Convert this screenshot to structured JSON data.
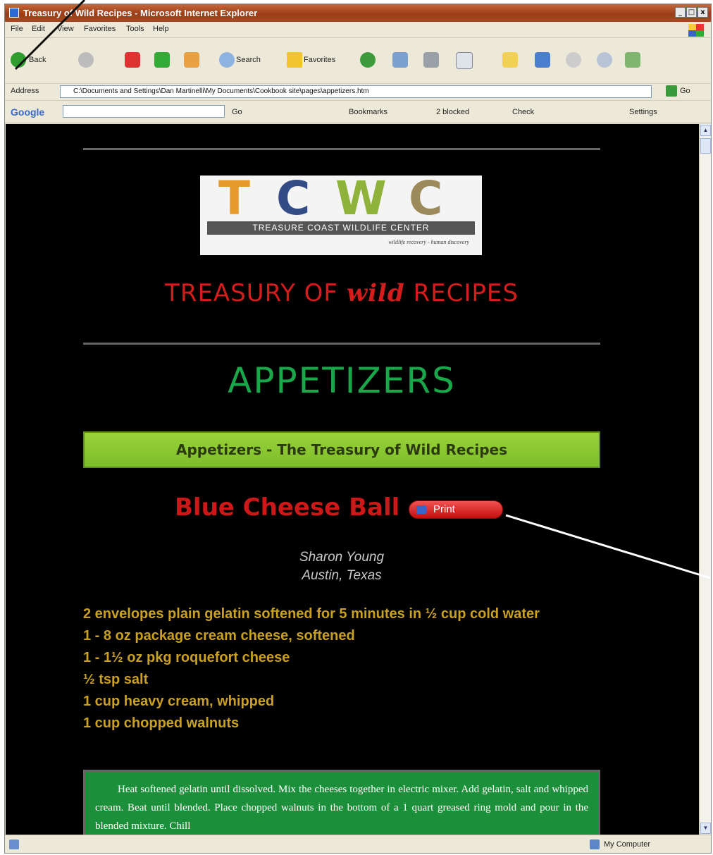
{
  "window": {
    "title": "Treasury of Wild Recipes - Microsoft Internet Explorer",
    "controls": [
      "_",
      "□",
      "x"
    ]
  },
  "menu": [
    "File",
    "Edit",
    "View",
    "Favorites",
    "Tools",
    "Help"
  ],
  "toolbar": {
    "back": "Back",
    "search": "Search",
    "favorites": "Favorites"
  },
  "address": {
    "label": "Address",
    "url": "C:\\Documents and Settings\\Dan Martinelli\\My Documents\\Cookbook site\\pages\\appetizers.htm",
    "go": "Go"
  },
  "google_bar": {
    "logo": "Google",
    "go": "Go",
    "bookmarks": "Bookmarks",
    "blocked": "2 blocked",
    "check": "Check",
    "settings": "Settings"
  },
  "status": {
    "zone": "My Computer"
  },
  "page": {
    "logo_letters": [
      "T",
      "C",
      "W",
      "C"
    ],
    "logo_band": "TREASURE COAST WILDLIFE CENTER",
    "logo_tag": "wildlife recovery - human discovery",
    "site_title_a": "TREASURY OF ",
    "site_title_wild": "wild",
    "site_title_b": " RECIPES",
    "section": "APPETIZERS",
    "banner": "Appetizers - The Treasury of Wild Recipes",
    "recipe_title": "Blue Cheese Ball",
    "print_label": "Print",
    "author_name": "Sharon Young",
    "author_place": "Austin, Texas",
    "ingredients": [
      "2 envelopes plain gelatin softened for 5 minutes in ½ cup cold water",
      "1 - 8 oz package cream cheese, softened",
      "1 - 1½ oz pkg roquefort cheese",
      "½ tsp salt",
      "1 cup heavy cream, whipped",
      "1 cup chopped walnuts"
    ],
    "directions": "Heat softened gelatin until dissolved. Mix the cheeses together in electric mixer. Add gelatin, salt and whipped cream. Beat until blended. Place chopped walnuts in the bottom of a 1 quart greased ring mold and pour in the blended mixture. Chill"
  },
  "colors": {
    "title_red": "#d41c1c",
    "section_green": "#1aa64a",
    "ingredient_gold": "#c9a020",
    "directions_bg": "#1c8f3a"
  }
}
